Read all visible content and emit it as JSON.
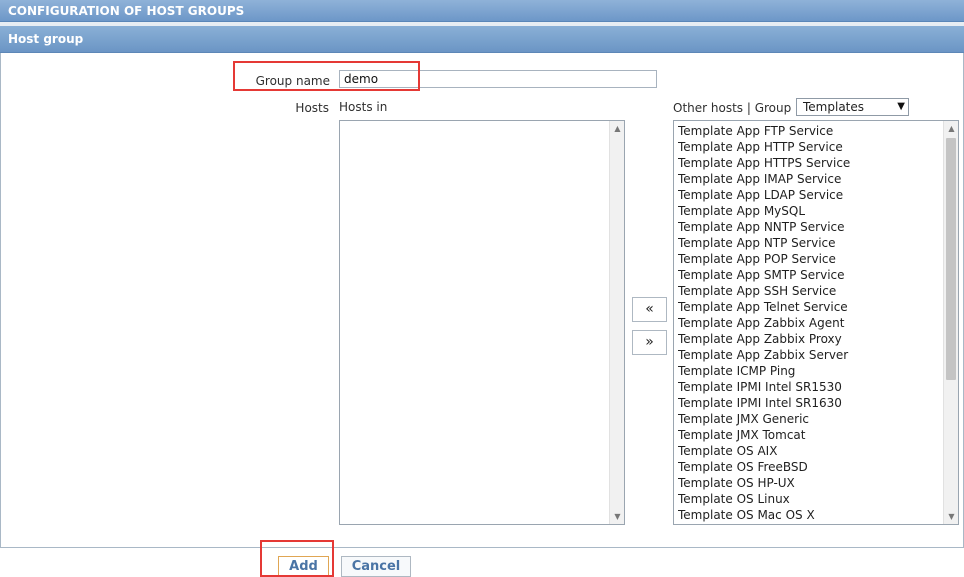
{
  "window": {
    "title": "CONFIGURATION OF HOST GROUPS",
    "section_title": "Host group"
  },
  "form": {
    "group_name_label": "Group name",
    "group_name_value": "demo",
    "hosts_label": "Hosts",
    "hosts_in_label": "Hosts in",
    "other_hosts_label": "Other hosts | Group",
    "group_select_value": "Templates",
    "hosts_in": [],
    "other_hosts": [
      "Template App FTP Service",
      "Template App HTTP Service",
      "Template App HTTPS Service",
      "Template App IMAP Service",
      "Template App LDAP Service",
      "Template App MySQL",
      "Template App NNTP Service",
      "Template App NTP Service",
      "Template App POP Service",
      "Template App SMTP Service",
      "Template App SSH Service",
      "Template App Telnet Service",
      "Template App Zabbix Agent",
      "Template App Zabbix Proxy",
      "Template App Zabbix Server",
      "Template ICMP Ping",
      "Template IPMI Intel SR1530",
      "Template IPMI Intel SR1630",
      "Template JMX Generic",
      "Template JMX Tomcat",
      "Template OS AIX",
      "Template OS FreeBSD",
      "Template OS HP-UX",
      "Template OS Linux",
      "Template OS Mac OS X"
    ],
    "move_left_label": "«",
    "move_right_label": "»",
    "dropdown_icon": "▼",
    "scroll_up_icon": "▲",
    "scroll_down_icon": "▼"
  },
  "buttons": {
    "add": "Add",
    "cancel": "Cancel"
  },
  "colors": {
    "header_blue": "#7ea5d0",
    "highlight_red": "#e53935",
    "button_text_blue": "#4a74a5"
  }
}
